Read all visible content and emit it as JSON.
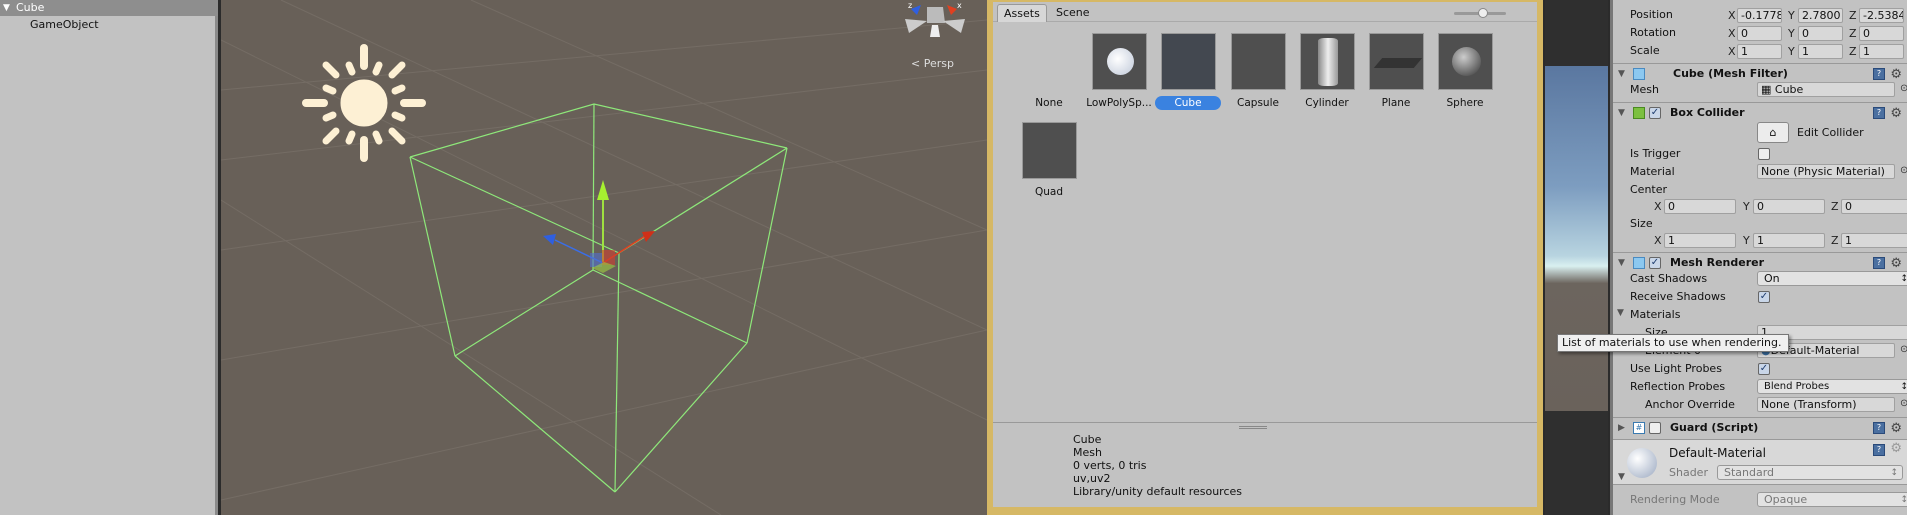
{
  "hierarchy": {
    "root": "Cube",
    "child": "GameObject"
  },
  "scene": {
    "view_mode": "Persp",
    "gizmo_axes": [
      "z",
      "x"
    ]
  },
  "picker": {
    "tabs": [
      "Assets",
      "Scene"
    ],
    "items": [
      {
        "label": "None"
      },
      {
        "label": "LowPolySp..."
      },
      {
        "label": "Cube",
        "selected": true
      },
      {
        "label": "Capsule"
      },
      {
        "label": "Cylinder"
      },
      {
        "label": "Plane"
      },
      {
        "label": "Sphere"
      },
      {
        "label": "Quad"
      }
    ],
    "info": [
      "Cube",
      "Mesh",
      "0 verts, 0 tris",
      "uv,uv2",
      "Library/unity default resources"
    ]
  },
  "inspector": {
    "transform": {
      "position": {
        "label": "Position",
        "x": "-0.1778",
        "y": "2.7800",
        "z": "-2.5384"
      },
      "rotation": {
        "label": "Rotation",
        "x": "0",
        "y": "0",
        "z": "0"
      },
      "scale": {
        "label": "Scale",
        "x": "1",
        "y": "1",
        "z": "1"
      }
    },
    "mesh_filter": {
      "title": "Cube (Mesh Filter)",
      "mesh_label": "Mesh",
      "mesh_value": "Cube"
    },
    "box_collider": {
      "title": "Box Collider",
      "edit_label": "Edit Collider",
      "is_trigger_label": "Is Trigger",
      "material_label": "Material",
      "material_value": "None (Physic Material)",
      "center_label": "Center",
      "center": {
        "x": "0",
        "y": "0",
        "z": "0"
      },
      "size_label": "Size",
      "size": {
        "x": "1",
        "y": "1",
        "z": "1"
      }
    },
    "mesh_renderer": {
      "title": "Mesh Renderer",
      "cast_shadows_label": "Cast Shadows",
      "cast_shadows_value": "On",
      "receive_shadows_label": "Receive Shadows",
      "materials_label": "Materials",
      "size_label": "Size",
      "size_value": "1",
      "element0_label": "Element 0",
      "element0_value": "Default-Material",
      "light_probes_label": "Use Light Probes",
      "reflection_label": "Reflection Probes",
      "reflection_value": "Blend Probes",
      "anchor_label": "Anchor Override",
      "anchor_value": "None (Transform)"
    },
    "guard": {
      "title": "Guard (Script)"
    },
    "material": {
      "title": "Default-Material",
      "shader_label": "Shader",
      "shader_value": "Standard",
      "rendering_mode_label": "Rendering Mode",
      "rendering_mode_value": "Opaque"
    },
    "axis": {
      "x": "X",
      "y": "Y",
      "z": "Z"
    }
  },
  "tooltip": "List of materials to use when rendering.",
  "colors": {
    "selection": "#3a82e0",
    "collider": "#8ee87a",
    "picker_border": "#d6b865"
  }
}
